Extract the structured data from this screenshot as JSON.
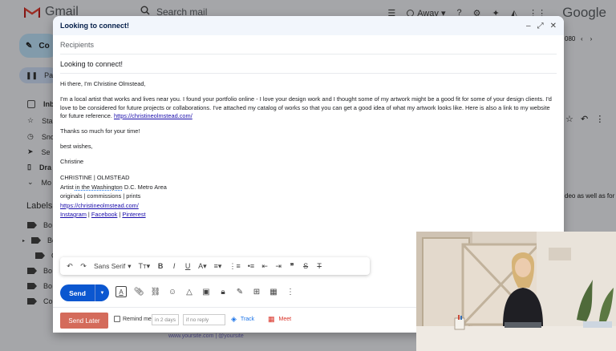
{
  "gmail": {
    "logo_text": "Gmail",
    "search_placeholder": "Search mail",
    "status": "Away",
    "google_text": "Google",
    "compose_label": "Co",
    "pause_label": "Pau",
    "pager_fragment": "080",
    "nav": [
      "Inb",
      "Sta",
      "Sno",
      "Se",
      "Dra",
      "Mo"
    ],
    "labels_title": "Labels",
    "labels": [
      "Bo",
      "Bo",
      "C",
      "Bo",
      "Bo",
      "Co"
    ],
    "reading_fragment": "deo as well as for",
    "below_fragment": "www.yoursite.com | @yoursite"
  },
  "compose": {
    "title": "Looking to connect!",
    "recipients_placeholder": "Recipients",
    "subject": "Looking to connect!",
    "greeting": "Hi there, I'm Christine Olmstead,",
    "paragraph": "I'm a local artist that works and lives near you. I found your portfolio online - I love your design work and I thought some of my artwork might be a good fit for some of your design clients. I'd love to be considered for future projects or collaborations. I've attached my catalog of works so that you can get a good idea of what my artwork looks like. Here is also a link to my website for future reference.",
    "paragraph_link": "https://christineolmstead.com/",
    "thanks": "Thanks so much for your time!",
    "closing": "best wishes,",
    "name": "Christine",
    "sig_name": "CHRISTINE | OLMSTEAD",
    "sig_title_a": "Artist ",
    "sig_title_b": "in the Washington",
    "sig_title_c": " D.C. Metro Area",
    "sig_services": "originals | commissions | prints",
    "sig_link": "https://christineolmstead.com/",
    "sig_social_1": "Instagram",
    "sig_social_2": "Facebook",
    "sig_social_3": "Pinterest",
    "sep": " | "
  },
  "toolbar": {
    "font": "Sans Serif"
  },
  "actions": {
    "send": "Send",
    "send_later": "Send Later",
    "remind_me": "Remind me",
    "in_days": "in 2 days",
    "no_reply": "if no reply",
    "track": "Track",
    "meet": "Meet"
  },
  "colors": {
    "send_blue": "#0b57d0",
    "send_later": "#d46b5b",
    "link": "#1a0dab"
  }
}
